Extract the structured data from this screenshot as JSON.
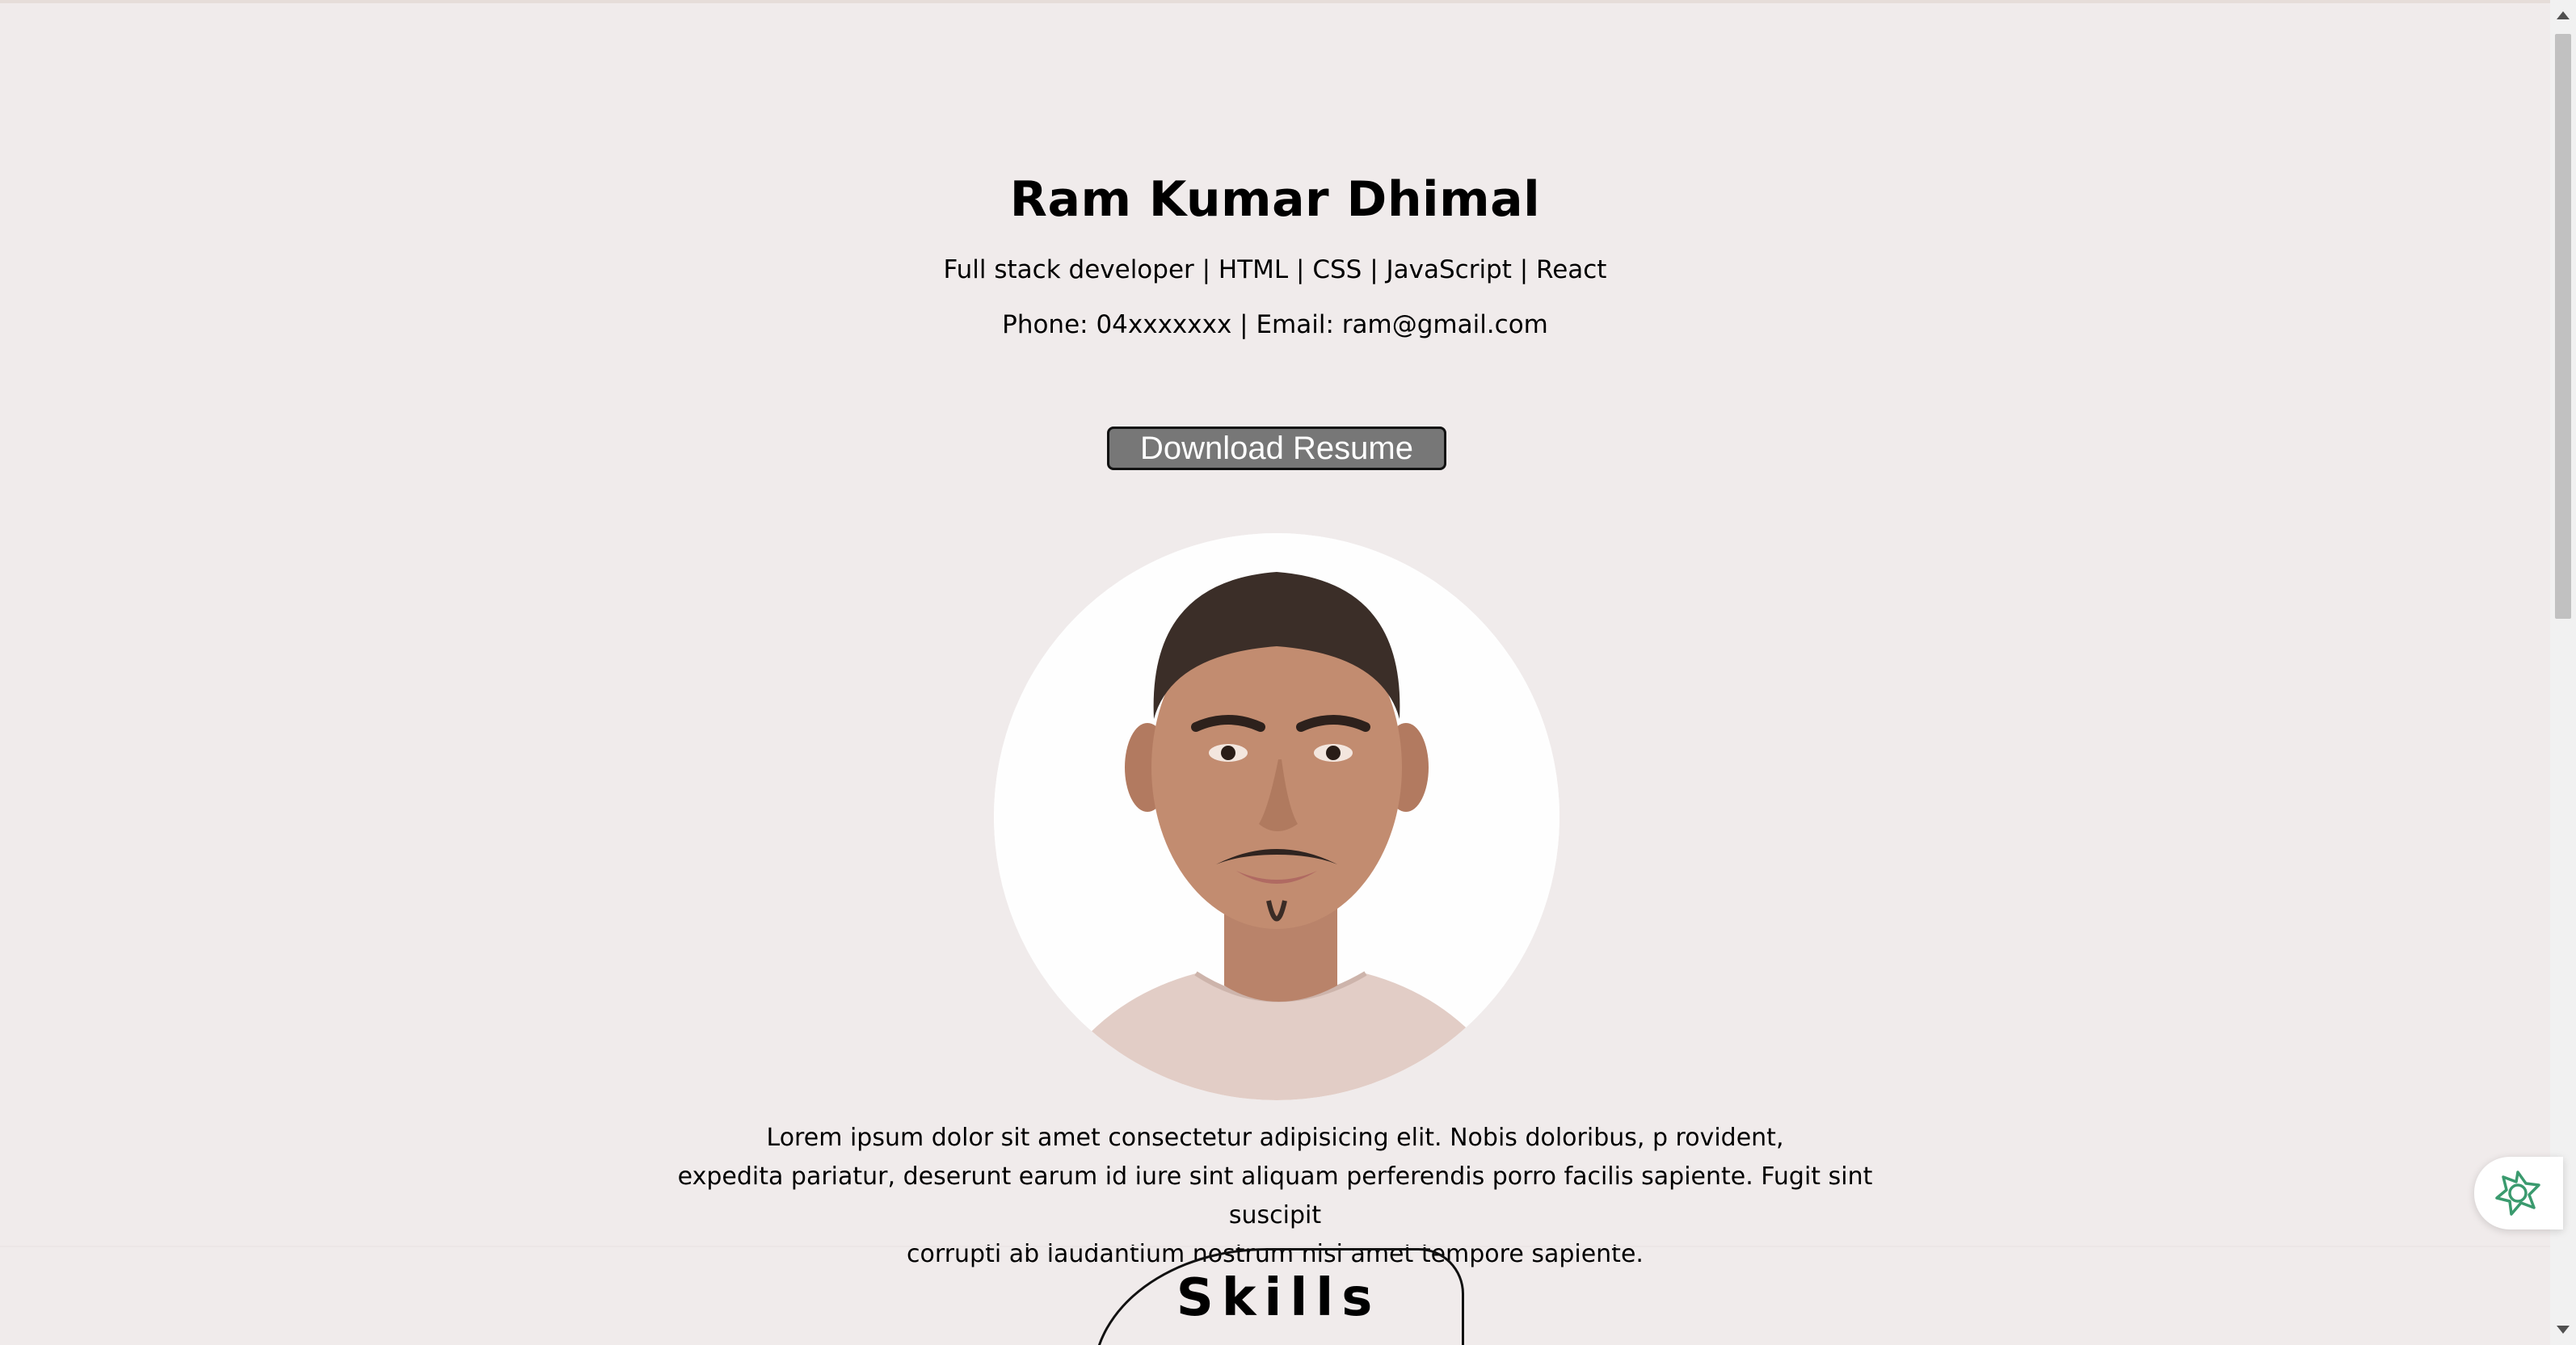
{
  "header": {
    "name": "Ram Kumar Dhimal",
    "role": "Full stack developer | HTML | CSS | JavaScript | React",
    "contact": "Phone: 04xxxxxxx | Email: ram@gmail.com",
    "download_label": "Download Resume"
  },
  "about": {
    "line1": "Lorem ipsum dolor sit amet consectetur adipisicing elit. Nobis doloribus, p rovident,",
    "line2": "expedita pariatur, deserunt earum id iure sint aliquam perferendis porro facilis sapiente. Fugit sint suscipit",
    "line3": "corrupti ab laudantium nostrum nisi amet tempore sapiente."
  },
  "skills": {
    "title": "Skills"
  },
  "widget": {
    "icon": "assistant-knot-icon",
    "color": "#3a9a6e"
  },
  "colors": {
    "background": "#f0ebeb",
    "button": "#777777"
  }
}
